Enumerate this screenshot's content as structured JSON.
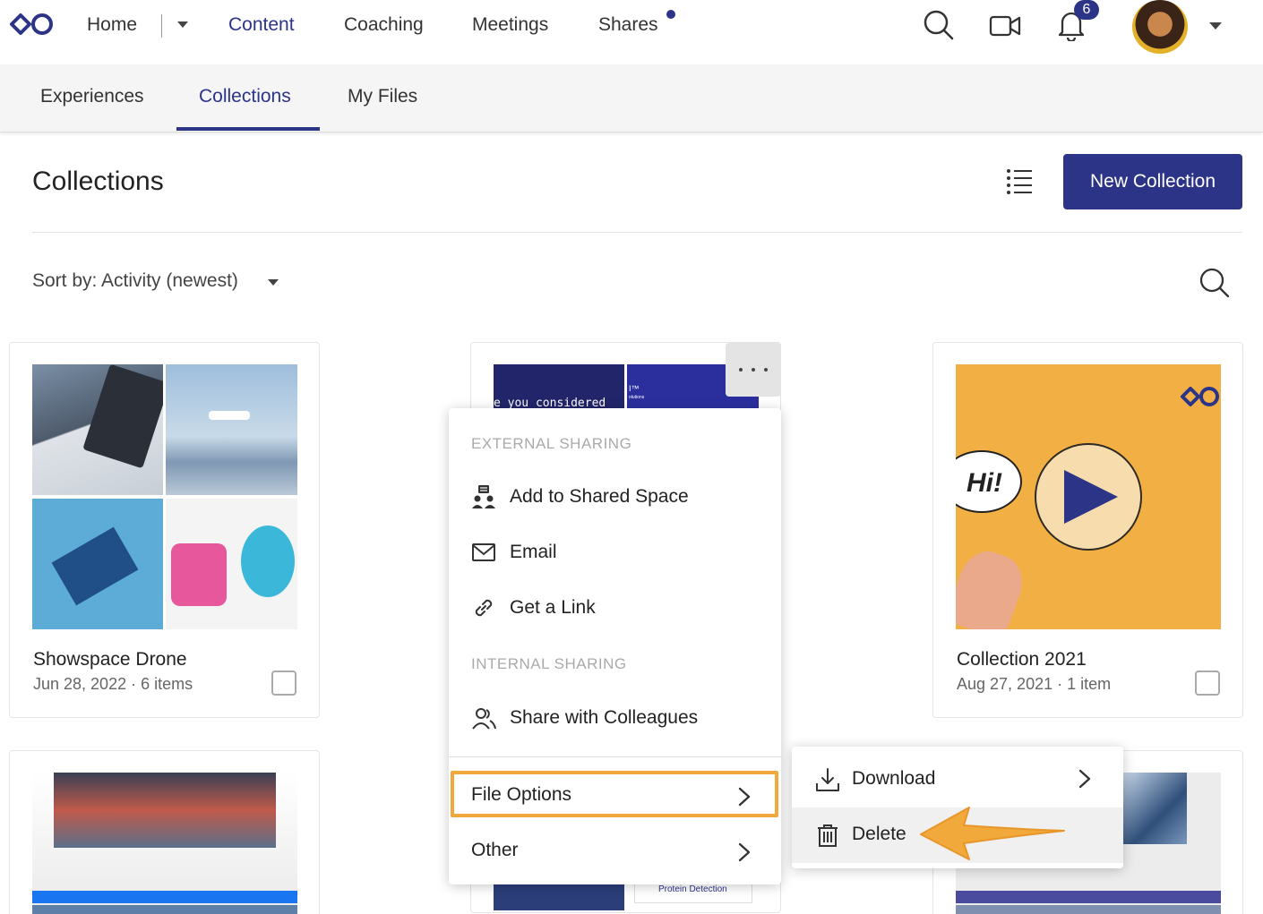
{
  "topnav": {
    "items": [
      "Home",
      "Content",
      "Coaching",
      "Meetings",
      "Shares"
    ],
    "active": "Content",
    "notification_count": "6"
  },
  "subnav": {
    "items": [
      "Experiences",
      "Collections",
      "My Files"
    ],
    "active": "Collections"
  },
  "page": {
    "title": "Collections",
    "new_button": "New Collection",
    "sort_label": "Sort by: Activity (newest)"
  },
  "cards": [
    {
      "title": "Showspace Drone",
      "meta": "Jun 28, 2022 · 6 items"
    },
    {
      "title": "Collection 2021",
      "meta": "Aug 27, 2021 · 1 item"
    }
  ],
  "thumb_text": {
    "card2_strip": "e you considered",
    "card2_small": "I™",
    "card2_tiny": "olutions",
    "hi_bubble": "Hi!",
    "protein": "Protein Detection"
  },
  "menu": {
    "external_heading": "EXTERNAL SHARING",
    "add_shared_space": "Add to Shared Space",
    "email": "Email",
    "get_link": "Get a Link",
    "internal_heading": "INTERNAL SHARING",
    "share_colleagues": "Share with Colleagues",
    "file_options": "File Options",
    "other": "Other"
  },
  "submenu": {
    "download": "Download",
    "delete": "Delete"
  },
  "colors": {
    "accent": "#2c3488",
    "highlight": "#f2a93b",
    "card_orange": "#f2b044"
  }
}
